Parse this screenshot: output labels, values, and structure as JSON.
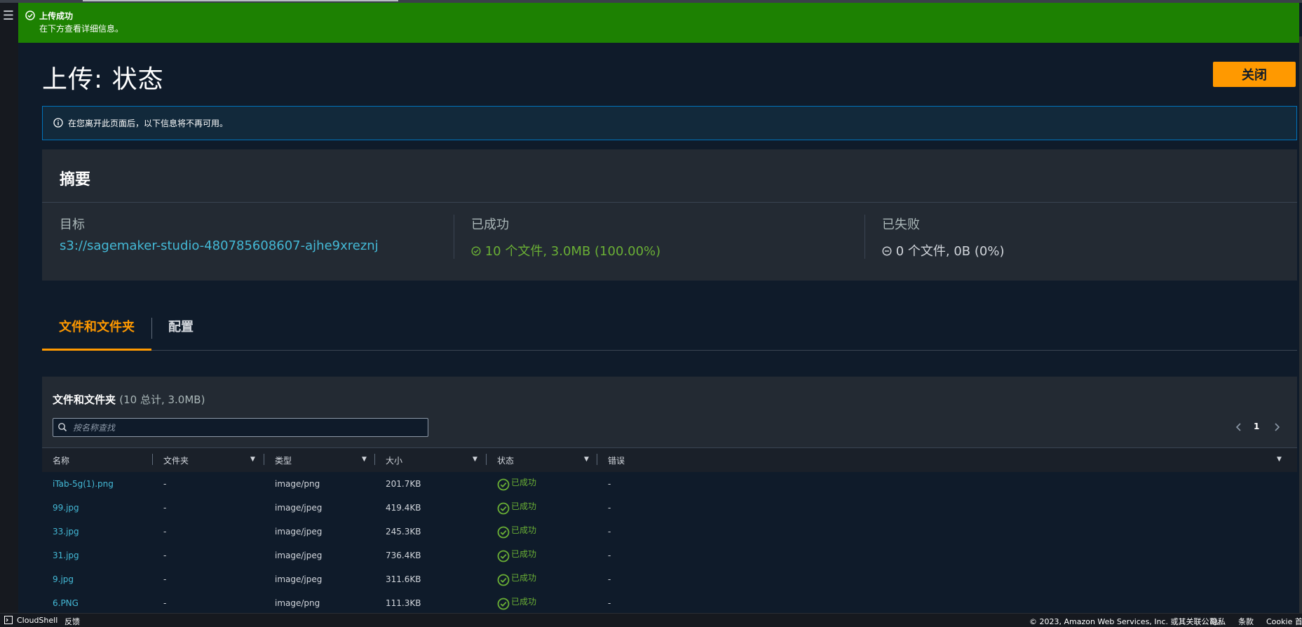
{
  "flash": {
    "title": "上传成功",
    "subtitle": "在下方查看详细信息。"
  },
  "header": {
    "title": "上传: 状态",
    "close_label": "关闭"
  },
  "info_alert": {
    "text": "在您离开此页面后，以下信息将不再可用。"
  },
  "summary": {
    "heading": "摘要",
    "destination_label": "目标",
    "destination_value": "s3://sagemaker-studio-480785608607-ajhe9xreznj",
    "succeeded_label": "已成功",
    "succeeded_value": "10 个文件, 3.0MB (100.00%)",
    "failed_label": "已失败",
    "failed_value": "0 个文件, 0B (0%)"
  },
  "tabs": [
    {
      "label": "文件和文件夹",
      "active": true
    },
    {
      "label": "配置",
      "active": false
    }
  ],
  "files_panel": {
    "title": "文件和文件夹",
    "count": "(10 总计, 3.0MB)",
    "search_placeholder": "按名称查找",
    "page": "1",
    "columns": [
      "名称",
      "文件夹",
      "类型",
      "大小",
      "状态",
      "错误"
    ],
    "rows": [
      {
        "name": "iTab-5g(1).png",
        "folder": "-",
        "type": "image/png",
        "size": "201.7KB",
        "status": "已成功",
        "error": "-"
      },
      {
        "name": "99.jpg",
        "folder": "-",
        "type": "image/jpeg",
        "size": "419.4KB",
        "status": "已成功",
        "error": "-"
      },
      {
        "name": "33.jpg",
        "folder": "-",
        "type": "image/jpeg",
        "size": "245.3KB",
        "status": "已成功",
        "error": "-"
      },
      {
        "name": "31.jpg",
        "folder": "-",
        "type": "image/jpeg",
        "size": "736.4KB",
        "status": "已成功",
        "error": "-"
      },
      {
        "name": "9.jpg",
        "folder": "-",
        "type": "image/jpeg",
        "size": "311.6KB",
        "status": "已成功",
        "error": "-"
      },
      {
        "name": "6.PNG",
        "folder": "-",
        "type": "image/png",
        "size": "111.3KB",
        "status": "已成功",
        "error": "-"
      }
    ]
  },
  "footer": {
    "cloudshell": "CloudShell",
    "feedback": "反馈",
    "copyright": "© 2023, Amazon Web Services, Inc. 或其关联公司。",
    "privacy": "隐私",
    "terms": "条款",
    "cookie": "Cookie 首选项"
  },
  "colors": {
    "success_green": "#1d8102",
    "accent_orange": "#ff9900",
    "link_blue": "#44b9d6",
    "status_green": "#6aaf35"
  },
  "icons": [
    "menu-icon",
    "check-circle-icon",
    "info-icon",
    "minus-circle-icon",
    "search-icon",
    "chevron-left-icon",
    "chevron-right-icon",
    "caret-down-icon",
    "cloudshell-icon"
  ]
}
